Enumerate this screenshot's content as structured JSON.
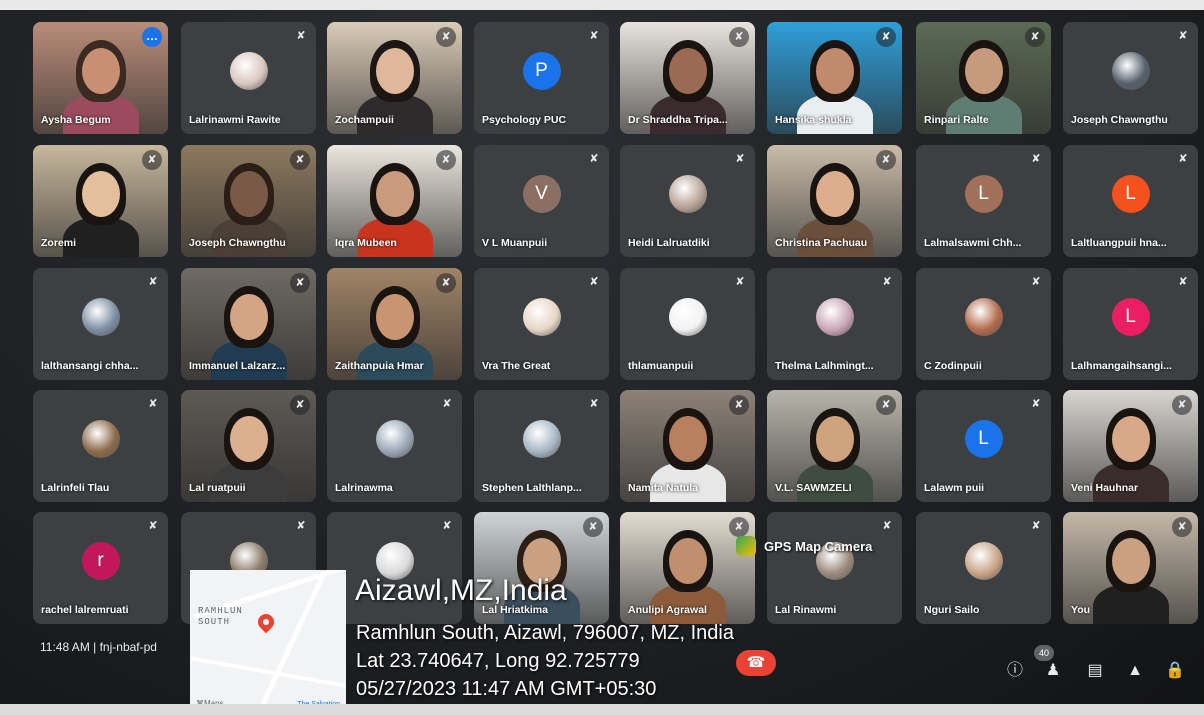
{
  "participants": [
    {
      "name": "Aysha Begum",
      "kind": "video",
      "bg": "#b98c79",
      "skin": "#c98f72",
      "hair": "#3a2a22",
      "shirt": "#9c4b5e",
      "pinned": true
    },
    {
      "name": "Lalrinawmi Rawite",
      "kind": "pic",
      "pic": "#d8c7bf"
    },
    {
      "name": "Zochampuii",
      "kind": "video",
      "bg": "#d9cbb7",
      "skin": "#e0b79a",
      "hair": "#1c1714",
      "shirt": "#2f2a2b"
    },
    {
      "name": "Psychology PUC",
      "kind": "letter",
      "letter": "P",
      "color": "#1a73e8"
    },
    {
      "name": "Dr Shraddha Tripa...",
      "kind": "video",
      "bg": "#e8e4dd",
      "skin": "#9b6a52",
      "hair": "#1a1411",
      "shirt": "#3b2a2e"
    },
    {
      "name": "Hansika shukla",
      "kind": "video",
      "bg": "#2f9fd9",
      "skin": "#c28a6d",
      "hair": "#1a1411",
      "shirt": "#e9eef1"
    },
    {
      "name": "Rinpari Ralte",
      "kind": "video",
      "bg": "#5c6a55",
      "skin": "#c89a7d",
      "hair": "#1a1411",
      "shirt": "#5f7d72"
    },
    {
      "name": "Joseph Chawngthu",
      "kind": "pic",
      "pic": "#56606b"
    },
    {
      "name": "Zoremi",
      "kind": "video",
      "bg": "#c7b79d",
      "skin": "#e3bf9e",
      "hair": "#1a1411",
      "shirt": "#202020"
    },
    {
      "name": "Joseph Chawngthu",
      "kind": "video",
      "bg": "#8c7960",
      "skin": "#7a5a46",
      "hair": "#2a1e17",
      "shirt": "#4b4036"
    },
    {
      "name": "Iqra Mubeen",
      "kind": "video",
      "bg": "#ebe6dd",
      "skin": "#c99a7c",
      "hair": "#1a1411",
      "shirt": "#c8341e"
    },
    {
      "name": "V L Muanpuii",
      "kind": "letter",
      "letter": "V",
      "color": "#8d6e63"
    },
    {
      "name": "Heidi Lalruatdiki",
      "kind": "pic",
      "pic": "#b9a497"
    },
    {
      "name": "Christina Pachuau",
      "kind": "video",
      "bg": "#c9bca9",
      "skin": "#dcae8c",
      "hair": "#1a1411",
      "shirt": "#6b4f3d"
    },
    {
      "name": "Lalmalsawmi Chh...",
      "kind": "letter",
      "letter": "L",
      "color": "#a1705a"
    },
    {
      "name": "Laltluangpuii hna...",
      "kind": "letter",
      "letter": "L",
      "color": "#f4511e"
    },
    {
      "name": "lalthansangi chha...",
      "kind": "pic",
      "pic": "#7d8fa3"
    },
    {
      "name": "Immanuel Lalzarz...",
      "kind": "video",
      "bg": "#6f6a63",
      "skin": "#d3a584",
      "hair": "#1a1411",
      "shirt": "#203b52"
    },
    {
      "name": "Zaithanpuia Hmar",
      "kind": "video",
      "bg": "#a08467",
      "skin": "#c99472",
      "hair": "#1a1411",
      "shirt": "#2b4a5a"
    },
    {
      "name": "Vra The Great",
      "kind": "pic",
      "pic": "#e7d6c4"
    },
    {
      "name": "thlamuanpuii",
      "kind": "pic",
      "pic": "#f2f2f2"
    },
    {
      "name": "Thelma Lalhmingt...",
      "kind": "pic",
      "pic": "#c9a6b6"
    },
    {
      "name": "C Zodinpuii",
      "kind": "pic",
      "pic": "#b36b4c"
    },
    {
      "name": "Lalhmangaihsangi...",
      "kind": "letter",
      "letter": "L",
      "color": "#e91e63"
    },
    {
      "name": "Lalrinfeli Tlau",
      "kind": "pic",
      "pic": "#8b6a4a"
    },
    {
      "name": "Lal ruatpuii",
      "kind": "video",
      "bg": "#5d5a55",
      "skin": "#dcb08f",
      "hair": "#1a1411",
      "shirt": "#3c3c3c"
    },
    {
      "name": "Lalrinawma",
      "kind": "pic",
      "pic": "#9aa7b5"
    },
    {
      "name": "Stephen Lalthlanp...",
      "kind": "pic",
      "pic": "#a7b6c4"
    },
    {
      "name": "Namita Natula",
      "kind": "video",
      "bg": "#8d8278",
      "skin": "#b9805f",
      "hair": "#1a1411",
      "shirt": "#e7e7e7"
    },
    {
      "name": "V.L. SAWMZELI",
      "kind": "video",
      "bg": "#b6b4a9",
      "skin": "#cfa27e",
      "hair": "#1a1411",
      "shirt": "#3e4d3f"
    },
    {
      "name": "Lalawm puii",
      "kind": "letter",
      "letter": "L",
      "color": "#1a73e8"
    },
    {
      "name": "Veni Hauhnar",
      "kind": "video",
      "bg": "#d7d4cf",
      "skin": "#d8a989",
      "hair": "#1a1411",
      "shirt": "#3a2c2a"
    },
    {
      "name": "rachel lalremruati",
      "kind": "letter",
      "letter": "r",
      "color": "#c2185b"
    },
    {
      "name": "",
      "kind": "pic",
      "pic": "#8a7a6a"
    },
    {
      "name": "",
      "kind": "pic",
      "pic": "#d9d9d9"
    },
    {
      "name": "Lal Hriatkima",
      "kind": "video",
      "bg": "#cfd4d6",
      "skin": "#caa081",
      "hair": "#2a1e17",
      "shirt": "#3b4e5d"
    },
    {
      "name": "Anulipi Agrawal",
      "kind": "video",
      "bg": "#e3dcd1",
      "skin": "#bf8f70",
      "hair": "#1a1411",
      "shirt": "#8c5b3c"
    },
    {
      "name": "Lal Rinawmi",
      "kind": "pic",
      "pic": "#9b8a7d"
    },
    {
      "name": "Nguri Sailo",
      "kind": "pic",
      "pic": "#c8a487"
    },
    {
      "name": "You",
      "kind": "video",
      "bg": "#c3b8a8",
      "skin": "#caa081",
      "hair": "#1a1411",
      "shirt": "#202020"
    }
  ],
  "footer": {
    "time_meeting": "11:48 AM  |  fnj-nbaf-pd"
  },
  "controls": {
    "people_count": "40"
  },
  "gps": {
    "app_name": "GPS Map Camera",
    "title": "Aizawl,MZ,India",
    "address": "Ramhlun South, Aizawl, 796007, MZ, India",
    "coords": "Lat 23.740647, Long 92.725779",
    "datetime": "05/27/2023 11:47 AM GMT+05:30",
    "map_label": "RAMHLUN\nSOUTH",
    "maps_logo": "⌘Maps",
    "map_attr": "The Salvation"
  },
  "icons": {
    "mic_off": "mic-off-icon",
    "info": "info-icon",
    "people": "people-icon",
    "chat": "chat-icon",
    "activities": "activities-icon",
    "host": "host-controls-icon",
    "end": "end-call-icon",
    "more": "more-options-icon"
  }
}
